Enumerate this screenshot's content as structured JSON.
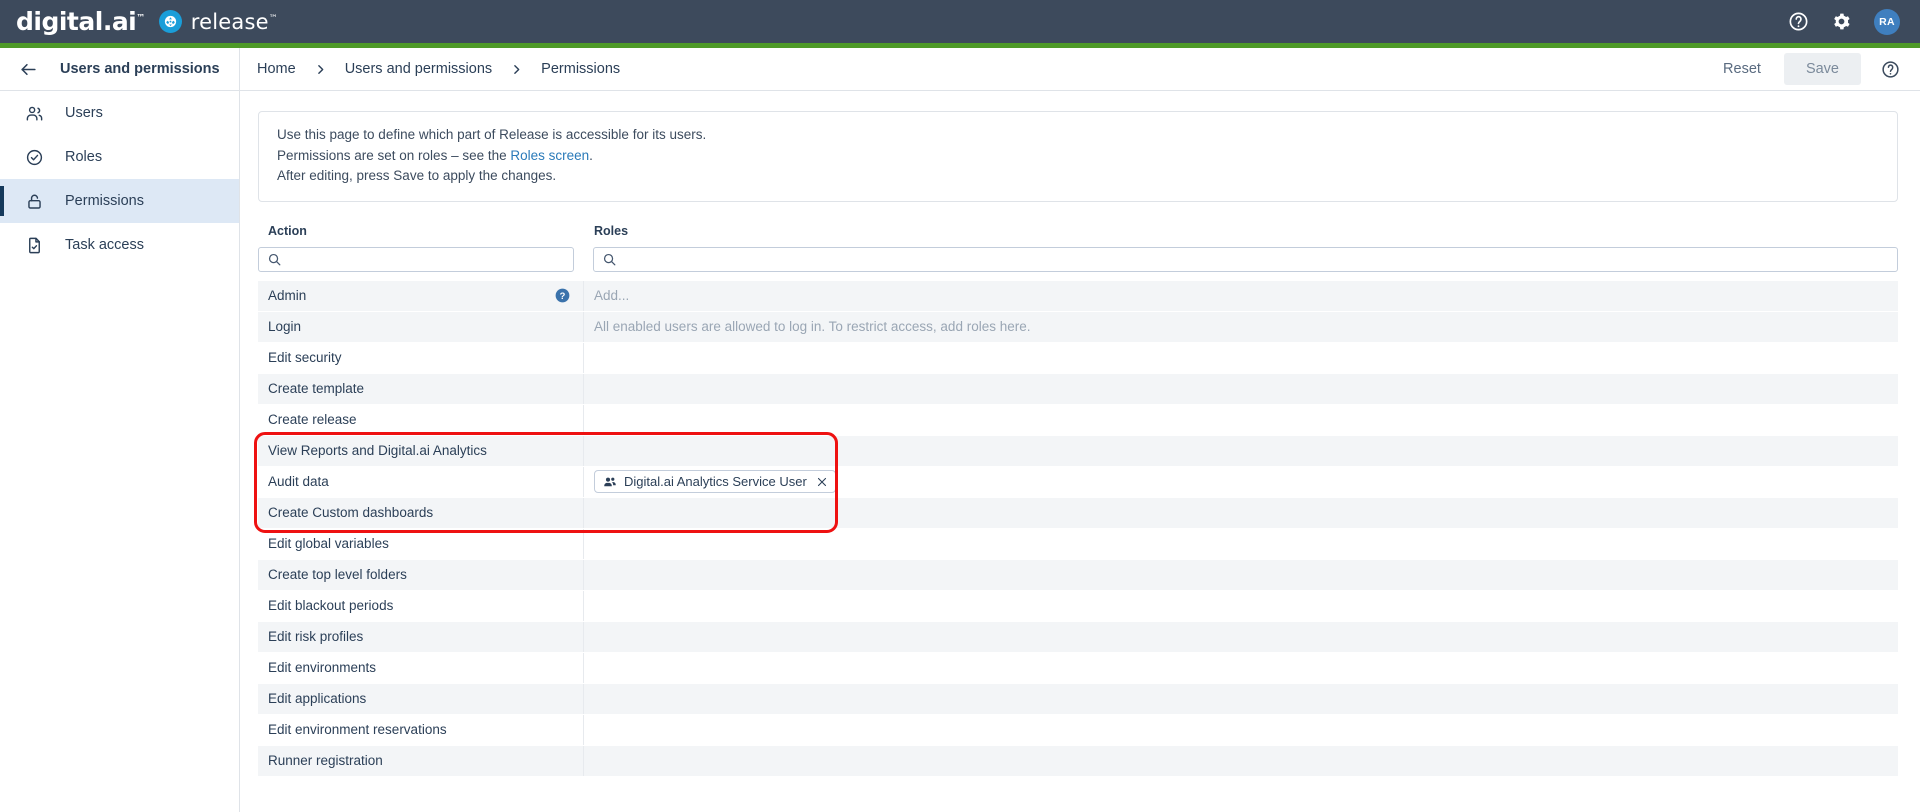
{
  "topbar": {
    "logo_text": "digital.ai",
    "logo_tm": "™",
    "product_name": "release",
    "product_tm": "™",
    "help_icon": "help-circle-icon",
    "settings_icon": "gear-icon",
    "avatar_initials": "RA",
    "accent_green": "#4e9a28",
    "bar_color": "#3d4a5c",
    "badge_color": "#1a9ed9"
  },
  "sidebar": {
    "back_icon": "arrow-left-icon",
    "title": "Users and permissions",
    "items": [
      {
        "label": "Users",
        "icon": "users-icon",
        "active": false
      },
      {
        "label": "Roles",
        "icon": "check-circle-icon",
        "active": false
      },
      {
        "label": "Permissions",
        "icon": "unlock-icon",
        "active": true
      },
      {
        "label": "Task access",
        "icon": "file-check-icon",
        "active": false
      }
    ],
    "active_bg": "#dde8f5",
    "active_accent": "#15395b"
  },
  "breadcrumb": {
    "items": [
      "Home",
      "Users and permissions",
      "Permissions"
    ],
    "separator": "›",
    "reset_label": "Reset",
    "save_label": "Save",
    "help_icon": "help-circle-icon"
  },
  "info_panel": {
    "line1": "Use this page to define which part of Release is accessible for its users.",
    "line2_prefix": "Permissions are set on roles – see the ",
    "line2_link": "Roles screen",
    "line2_suffix": ".",
    "line3": "After editing, press Save to apply the changes.",
    "link_color": "#2a7ab9"
  },
  "table": {
    "columns": {
      "action": "Action",
      "roles": "Roles"
    },
    "search_action": {
      "value": "",
      "placeholder": "",
      "icon": "search-icon"
    },
    "search_roles": {
      "value": "",
      "placeholder": "",
      "icon": "search-icon"
    },
    "rows": [
      {
        "action": "Admin",
        "has_help": true,
        "roles_hint": "Add...",
        "chips": [],
        "shade": "alt"
      },
      {
        "action": "Login",
        "has_help": false,
        "roles_hint": "All enabled users are allowed to log in. To restrict access, add roles here.",
        "chips": [],
        "shade": "alt"
      },
      {
        "action": "Edit security",
        "has_help": false,
        "roles_hint": "",
        "chips": [],
        "shade": "plain"
      },
      {
        "action": "Create template",
        "has_help": false,
        "roles_hint": "",
        "chips": [],
        "shade": "alt"
      },
      {
        "action": "Create release",
        "has_help": false,
        "roles_hint": "",
        "chips": [],
        "shade": "plain"
      },
      {
        "action": "View Reports and Digital.ai Analytics",
        "has_help": false,
        "roles_hint": "",
        "chips": [],
        "shade": "alt"
      },
      {
        "action": "Audit data",
        "has_help": false,
        "roles_hint": "",
        "chips": [
          {
            "label": "Digital.ai Analytics Service User",
            "icon": "people-icon",
            "remove_icon": "close-icon"
          }
        ],
        "shade": "plain"
      },
      {
        "action": "Create Custom dashboards",
        "has_help": false,
        "roles_hint": "",
        "chips": [],
        "shade": "alt"
      },
      {
        "action": "Edit global variables",
        "has_help": false,
        "roles_hint": "",
        "chips": [],
        "shade": "plain"
      },
      {
        "action": "Create top level folders",
        "has_help": false,
        "roles_hint": "",
        "chips": [],
        "shade": "alt"
      },
      {
        "action": "Edit blackout periods",
        "has_help": false,
        "roles_hint": "",
        "chips": [],
        "shade": "plain"
      },
      {
        "action": "Edit risk profiles",
        "has_help": false,
        "roles_hint": "",
        "chips": [],
        "shade": "alt"
      },
      {
        "action": "Edit environments",
        "has_help": false,
        "roles_hint": "",
        "chips": [],
        "shade": "plain"
      },
      {
        "action": "Edit applications",
        "has_help": false,
        "roles_hint": "",
        "chips": [],
        "shade": "alt"
      },
      {
        "action": "Edit environment reservations",
        "has_help": false,
        "roles_hint": "",
        "chips": [],
        "shade": "plain"
      },
      {
        "action": "Runner registration",
        "has_help": false,
        "roles_hint": "",
        "chips": [],
        "shade": "alt"
      }
    ]
  },
  "annotation": {
    "color": "#ee1111",
    "covers_rows": [
      "View Reports and Digital.ai Analytics",
      "Audit data",
      "Create Custom dashboards"
    ]
  }
}
